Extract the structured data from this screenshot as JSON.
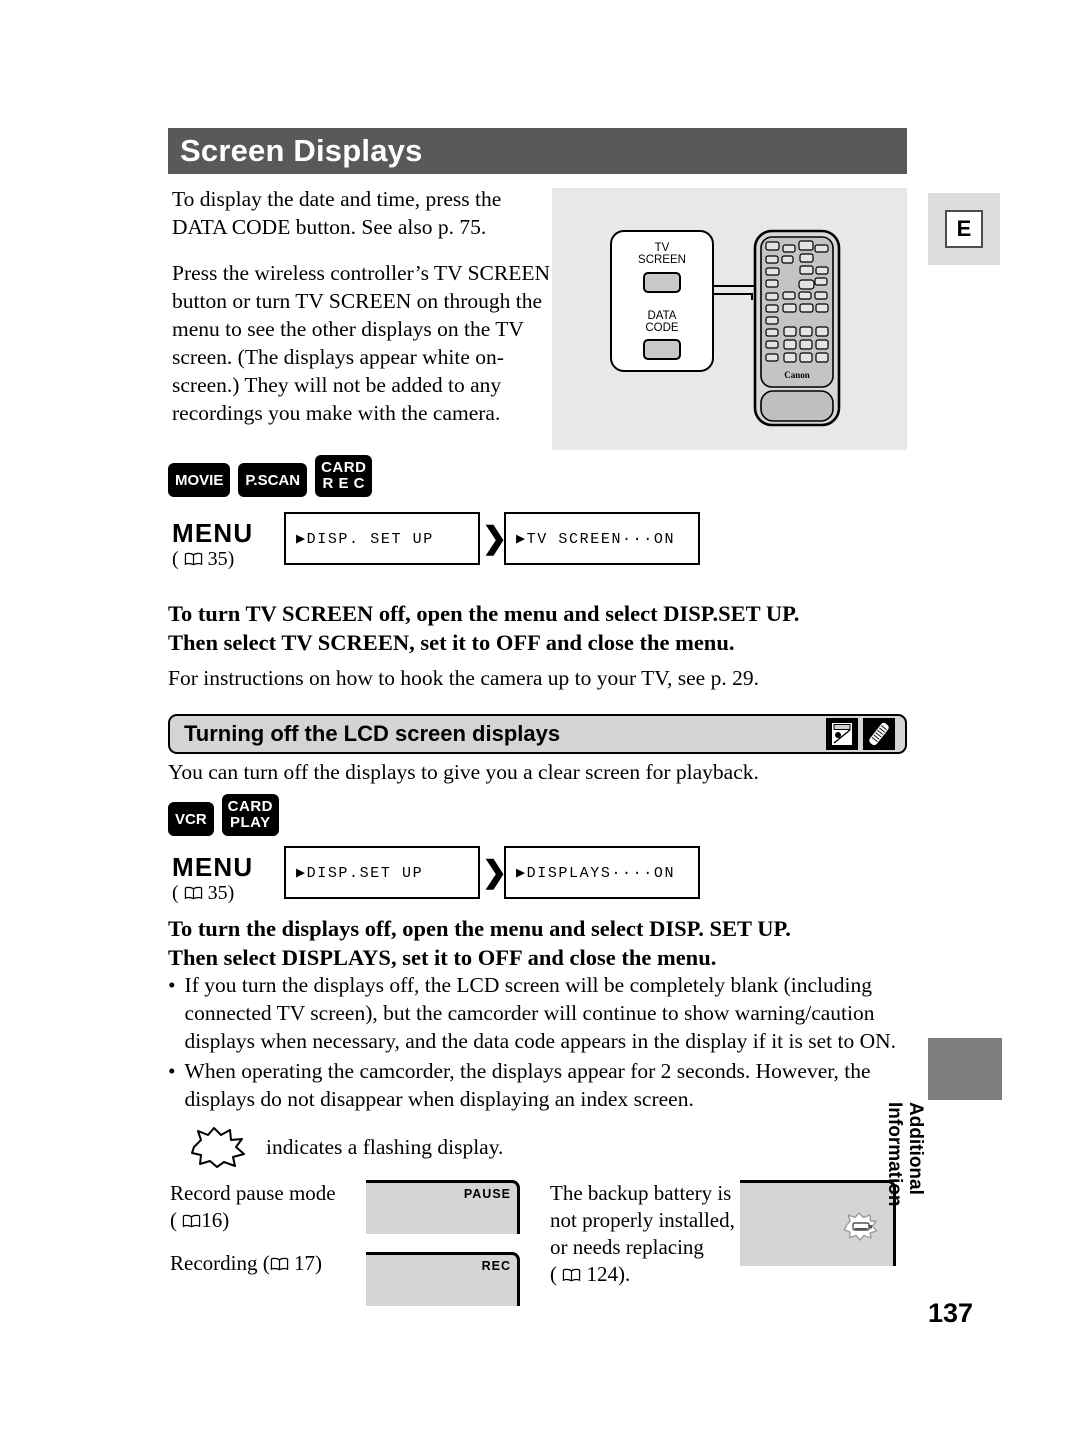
{
  "header": {
    "title": "Screen Displays"
  },
  "margin": {
    "edition_tab": "E",
    "section_label_line1": "Additional",
    "section_label_line2": "Information",
    "page_number": "137"
  },
  "intro": {
    "paragraph1": "To display the date and time, press the DATA CODE button. See also p. 75.",
    "paragraph2": "Press the wireless controller’s TV SCREEN button or turn TV SCREEN on through the menu to see the other displays on the TV screen. (The displays appear white on-screen.) They will not be added to any recordings you make with the camera."
  },
  "illustration": {
    "callout_label_line1": "TV",
    "callout_label_line2": "SCREEN",
    "callout_label_line3": "DATA",
    "callout_label_line4": "CODE",
    "brand": "Canon"
  },
  "section1": {
    "mode_badges": [
      {
        "line1": "MOVIE",
        "line2": ""
      },
      {
        "line1": "P.SCAN",
        "line2": ""
      },
      {
        "line1": "CARD",
        "line2": "R E C"
      }
    ],
    "menu_word": "MENU",
    "menu_ref": "35",
    "menu_step1": "▶DISP. SET UP",
    "menu_arrow": "❯❯",
    "menu_step2": "▶TV SCREEN···ON",
    "bold_instruction_line1": "To turn TV SCREEN off, open the menu and select DISP.SET UP.",
    "bold_instruction_line2": "Then select TV SCREEN, set it to OFF and close the menu.",
    "note": "For instructions on how to hook the camera up to your TV, see p. 29."
  },
  "section2": {
    "heading": "Turning off the LCD screen displays",
    "heading_icons": [
      "lcd-screen-icon",
      "wireless-controller-icon"
    ],
    "lead": "You can turn off the displays to give you a clear screen for playback.",
    "mode_badges": [
      {
        "line1": "VCR",
        "line2": ""
      },
      {
        "line1": "CARD",
        "line2": "PLAY"
      }
    ],
    "menu_word": "MENU",
    "menu_ref": "35",
    "menu_step1": "▶DISP.SET UP",
    "menu_arrow": "❯❯",
    "menu_step2": "▶DISPLAYS····ON",
    "bold_instruction_line1": "To turn the displays off, open the menu and select DISP. SET UP.",
    "bold_instruction_line2": "Then select DISPLAYS, set it to OFF and close the menu.",
    "bullets": [
      "If you turn the displays off, the LCD screen will be completely blank (including connected TV screen), but the camcorder will continue to show warning/caution displays when necessary, and the data code appears in the display if it is set to ON.",
      "When operating the camcorder, the displays appear for 2 seconds. However, the displays do not disappear when displaying an index screen."
    ],
    "flashing_note": "indicates a flashing display."
  },
  "examples": [
    {
      "caption_line1": "Record pause mode",
      "caption_ref": "16",
      "osd": "PAUSE"
    },
    {
      "caption_line1": "Recording (",
      "caption_ref": "17",
      "osd": "REC"
    },
    {
      "caption_line1": "The backup battery is",
      "caption_line2": "not properly installed,",
      "caption_line3": "or needs replacing",
      "caption_ref": "124",
      "osd": ""
    }
  ],
  "colors": {
    "header_bar": "#595959",
    "subhead_bar": "#d4d4d4",
    "illustration_panel": "#e8e8e8",
    "screen_fill": "#d5d5d5",
    "margin_tab": "#7d7d7d",
    "edition_tab_bg": "#dcdcdc"
  }
}
